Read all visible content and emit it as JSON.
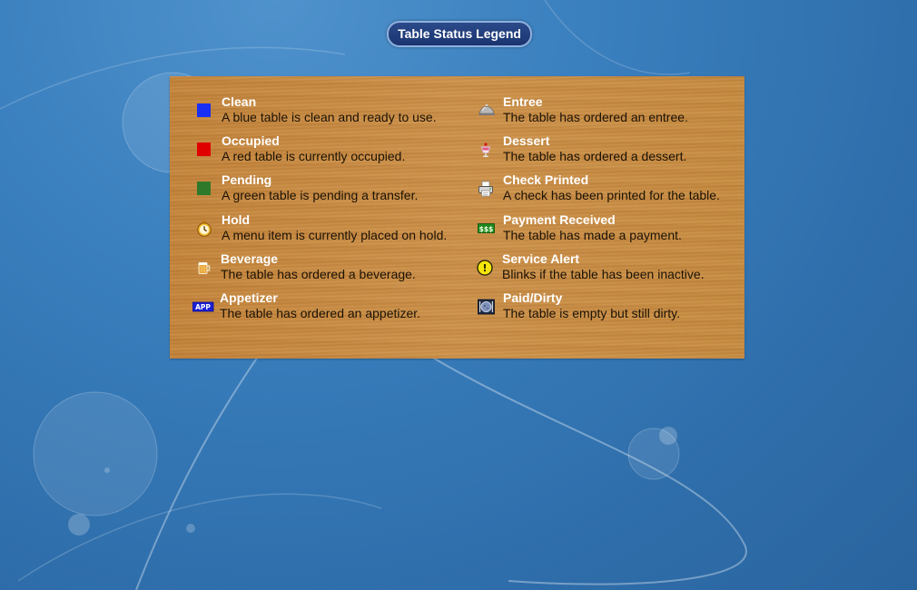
{
  "header": {
    "title": "Table Status Legend"
  },
  "legend": {
    "items": [
      {
        "title": "Clean",
        "desc": "A blue table is clean and ready to use.",
        "icon": "blue-square-icon",
        "color": "#1a2ff5"
      },
      {
        "title": "Occupied",
        "desc": "A red table is currently occupied.",
        "icon": "red-square-icon",
        "color": "#e00000"
      },
      {
        "title": "Pending",
        "desc": "A green table is pending a transfer.",
        "icon": "green-square-icon",
        "color": "#2e7a2a"
      },
      {
        "title": "Hold",
        "desc": "A menu item is currently placed on hold.",
        "icon": "stopwatch-icon"
      },
      {
        "title": "Beverage",
        "desc": "The table has ordered a beverage.",
        "icon": "beer-mug-icon"
      },
      {
        "title": "Appetizer",
        "desc": "The table has ordered an appetizer.",
        "icon": "app-badge-icon",
        "badge_text": "APP"
      },
      {
        "title": "Entree",
        "desc": "The table has ordered an entree.",
        "icon": "cloche-icon"
      },
      {
        "title": "Dessert",
        "desc": "The table has ordered a dessert.",
        "icon": "sundae-icon"
      },
      {
        "title": "Check Printed",
        "desc": "A check has been printed for the table.",
        "icon": "printer-icon"
      },
      {
        "title": "Payment Received",
        "desc": "The table has made a payment.",
        "icon": "money-icon",
        "badge_text": "$$$"
      },
      {
        "title": "Service Alert",
        "desc": "Blinks if the table has been inactive.",
        "icon": "alert-icon",
        "badge_text": "!"
      },
      {
        "title": "Paid/Dirty",
        "desc": "The table is empty but still dirty.",
        "icon": "dirty-plate-icon"
      }
    ]
  }
}
